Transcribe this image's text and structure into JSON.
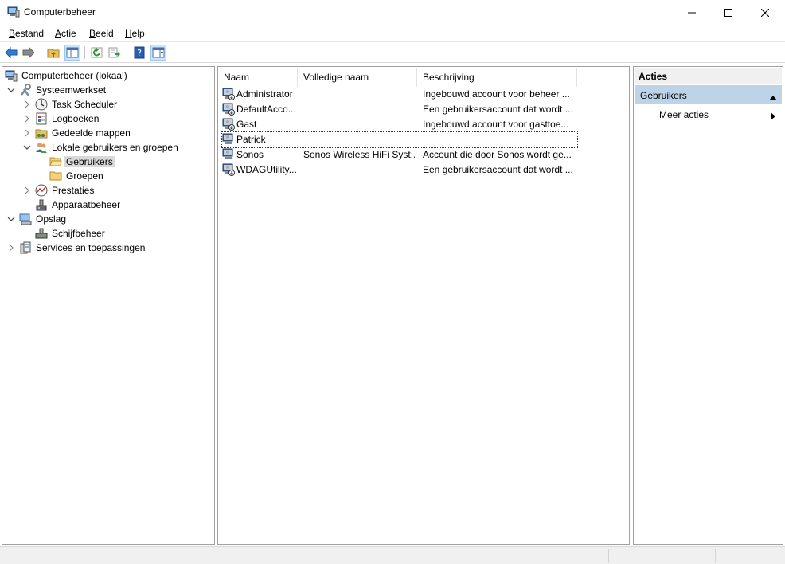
{
  "window": {
    "title": "Computerbeheer"
  },
  "menu": [
    {
      "key": "B",
      "rest": "estand"
    },
    {
      "key": "A",
      "rest": "ctie"
    },
    {
      "key": "B",
      "rest": "eeld"
    },
    {
      "key": "H",
      "rest": "elp"
    }
  ],
  "tree": [
    {
      "label": "Computerbeheer (lokaal)",
      "icon": "computer-management-icon",
      "state": "none"
    },
    {
      "label": "Systeemwerkset",
      "icon": "system-tools-icon",
      "state": "expanded"
    },
    {
      "label": "Task Scheduler",
      "icon": "clock-icon",
      "state": "collapsed"
    },
    {
      "label": "Logboeken",
      "icon": "event-viewer-icon",
      "state": "collapsed"
    },
    {
      "label": "Gedeelde mappen",
      "icon": "shared-folders-icon",
      "state": "collapsed"
    },
    {
      "label": "Lokale gebruikers en groepen",
      "icon": "users-groups-icon",
      "state": "expanded"
    },
    {
      "label": "Gebruikers",
      "icon": "folder-icon",
      "state": "none",
      "selected": true
    },
    {
      "label": "Groepen",
      "icon": "folder-icon",
      "state": "none"
    },
    {
      "label": "Prestaties",
      "icon": "performance-icon",
      "state": "collapsed"
    },
    {
      "label": "Apparaatbeheer",
      "icon": "device-manager-icon",
      "state": "none"
    },
    {
      "label": "Opslag",
      "icon": "storage-icon",
      "state": "expanded"
    },
    {
      "label": "Schijfbeheer",
      "icon": "disk-management-icon",
      "state": "none"
    },
    {
      "label": "Services en toepassingen",
      "icon": "services-icon",
      "state": "collapsed"
    }
  ],
  "list": {
    "columns": [
      "Naam",
      "Volledige naam",
      "Beschrijving"
    ],
    "rows": [
      {
        "name": "Administrator",
        "fullname": "",
        "description": "Ingebouwd account voor beheer ...",
        "disabled": true
      },
      {
        "name": "DefaultAcco...",
        "fullname": "",
        "description": "Een gebruikersaccount dat wordt ...",
        "disabled": true
      },
      {
        "name": "Gast",
        "fullname": "",
        "description": "Ingebouwd account voor gasttoe...",
        "disabled": true
      },
      {
        "name": "Patrick",
        "fullname": "",
        "description": "",
        "disabled": false,
        "focused": true
      },
      {
        "name": "Sonos",
        "fullname": "Sonos Wireless HiFi Syst...",
        "description": "Account die door Sonos wordt ge...",
        "disabled": false
      },
      {
        "name": "WDAGUtility...",
        "fullname": "",
        "description": "Een gebruikersaccount dat wordt ...",
        "disabled": true
      }
    ]
  },
  "actions": {
    "header": "Acties",
    "section": "Gebruikers",
    "more": "Meer acties"
  },
  "colors": {
    "selection": "#bed3e8",
    "toolbar_pressed": "#cce4f7"
  }
}
